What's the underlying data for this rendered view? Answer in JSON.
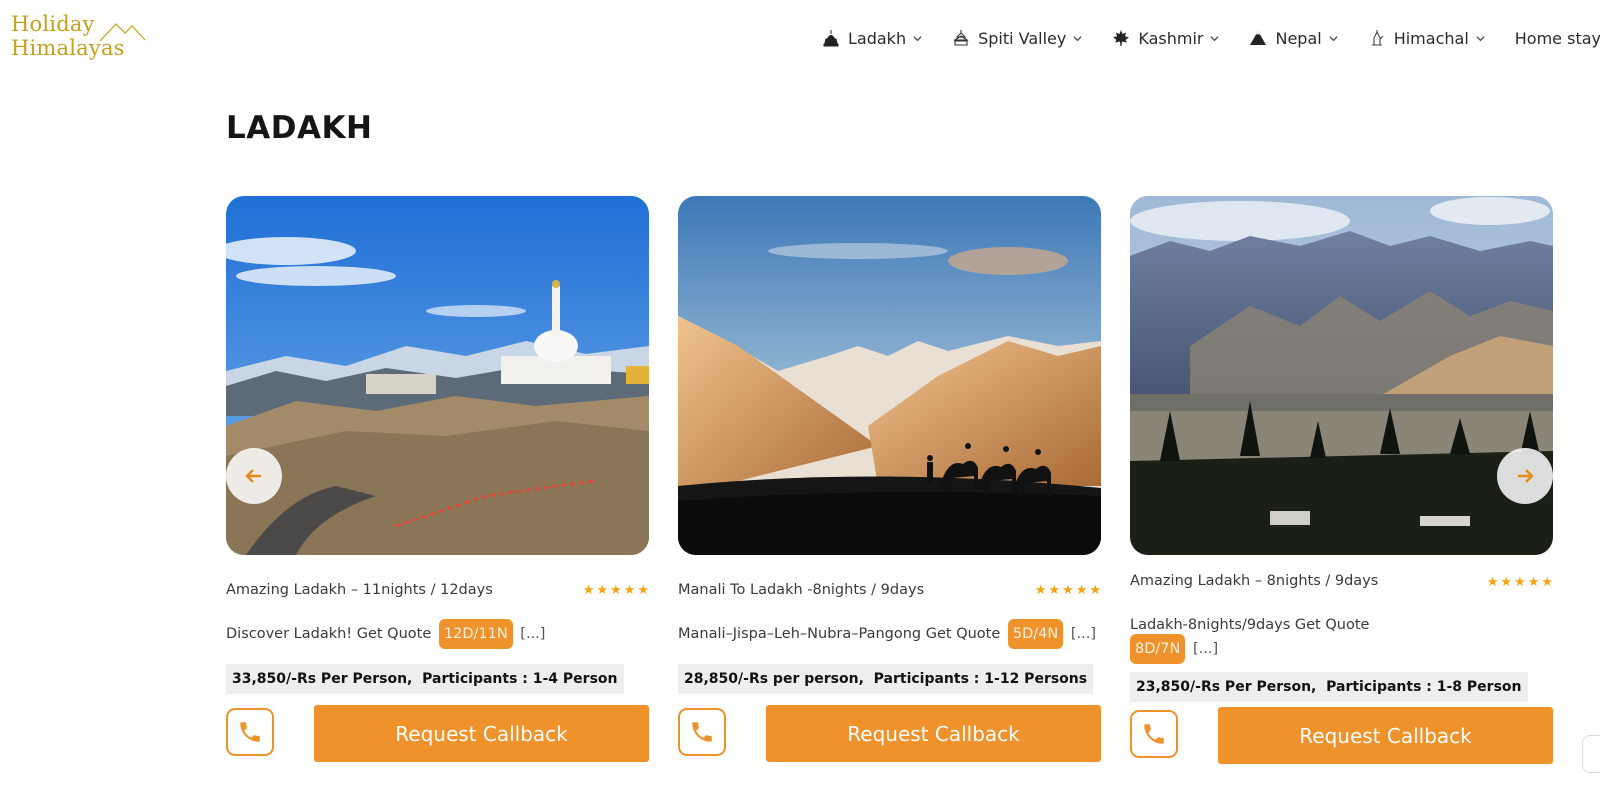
{
  "logo": {
    "line1": "Holiday",
    "line2": "Himalayas"
  },
  "nav": [
    {
      "label": "Ladakh",
      "icon": "stupa-icon"
    },
    {
      "label": "Spiti Valley",
      "icon": "monastery-icon"
    },
    {
      "label": "Kashmir",
      "icon": "maple-leaf-icon"
    },
    {
      "label": "Nepal",
      "icon": "mountain-icon"
    },
    {
      "label": "Himachal",
      "icon": "temple-icon"
    },
    {
      "label": "Home stays"
    }
  ],
  "section_title": "LADAKH",
  "cards": [
    {
      "name": "Amazing Ladakh – 11nights / 12days",
      "desc": "Discover Ladakh! Get Quote",
      "badge": "12D/11N",
      "more": "[...]",
      "price": "33,850/-Rs Per Person,",
      "participants": "Participants : 1-4 Person",
      "button": "Request Callback",
      "rating": 5
    },
    {
      "name": "Manali To Ladakh -8nights / 9days",
      "desc": "Manali–Jispa–Leh–Nubra–Pangong Get Quote",
      "badge": "5D/4N",
      "more": "[...]",
      "price": "28,850/-Rs per person,",
      "participants": "Participants : 1-12 Persons",
      "button": "Request Callback",
      "rating": 5
    },
    {
      "name": "Amazing Ladakh – 8nights / 9days",
      "desc": "Ladakh-8nights/9days Get Quote",
      "badge": "8D/7N",
      "more": "[...]",
      "price": "23,850/-Rs Per Person,",
      "participants": "Participants : 1-8 Person",
      "button": "Request Callback",
      "rating": 5
    }
  ],
  "colors": {
    "accent": "#f0922b",
    "logo": "#c4a01c",
    "star": "#f2a30f"
  }
}
